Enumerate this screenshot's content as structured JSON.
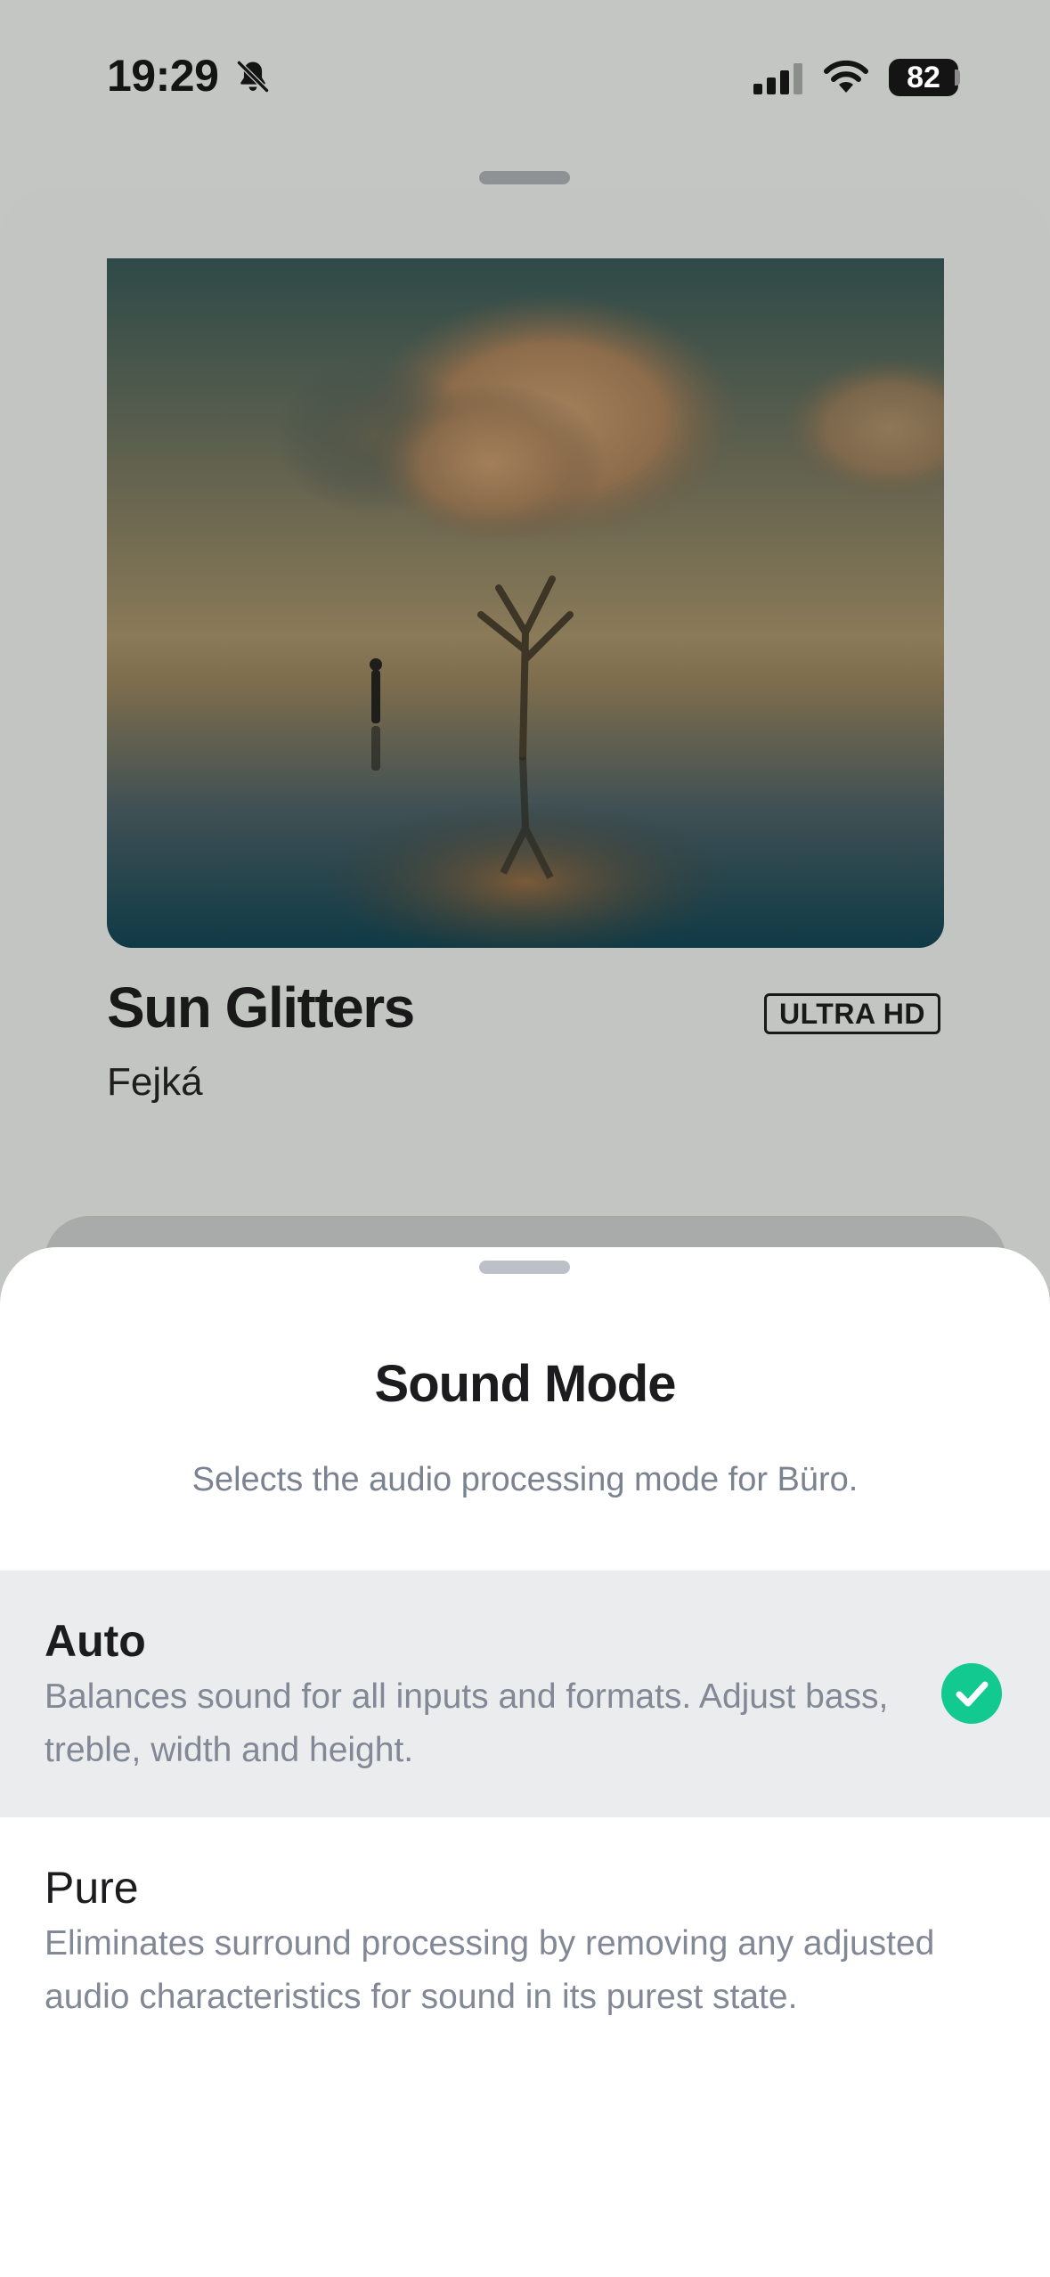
{
  "status_bar": {
    "time": "19:29",
    "battery": "82",
    "icons": [
      "bell-slash-icon",
      "cellular-signal-icon",
      "wifi-icon",
      "battery-icon"
    ]
  },
  "now_playing": {
    "title": "Sun Glitters",
    "artist": "Fejká",
    "quality_badge": "ULTRA HD",
    "artwork": "album-artwork"
  },
  "sound_mode_sheet": {
    "title": "Sound Mode",
    "subtitle": "Selects the audio processing mode for Büro.",
    "options": [
      {
        "name": "Auto",
        "description": "Balances sound for all inputs and formats. Adjust bass, treble, width and height.",
        "selected": true
      },
      {
        "name": "Pure",
        "description": "Eliminates surround processing by removing any adjusted audio characteristics for sound in its purest state.",
        "selected": false
      }
    ],
    "selected_icon": "checkmark-circle-icon"
  },
  "colors": {
    "accent_check": "#12c98f",
    "selected_row_bg": "#ebecee",
    "sheet_bg": "#ffffff",
    "dim_bg": "#c4c6c3",
    "secondary_text": "#828895"
  }
}
